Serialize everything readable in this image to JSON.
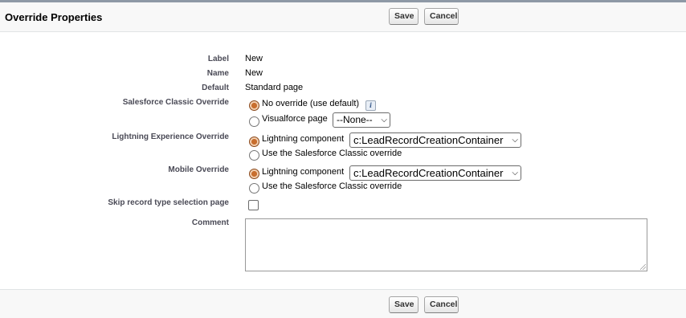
{
  "header": {
    "title": "Override Properties"
  },
  "buttons": {
    "save_label": "Save",
    "cancel_label": "Cancel"
  },
  "fields": {
    "label": {
      "label": "Label",
      "value": "New"
    },
    "name": {
      "label": "Name",
      "value": "New"
    },
    "default": {
      "label": "Default",
      "value": "Standard page"
    },
    "classic_override": {
      "label": "Salesforce Classic Override",
      "options": [
        "No override (use default)",
        "Visualforce page"
      ],
      "selected_index": 0,
      "vf_select_value": "--None--"
    },
    "lightning_override": {
      "label": "Lightning Experience Override",
      "options": [
        "Lightning component",
        "Use the Salesforce Classic override"
      ],
      "selected_index": 0,
      "component_value": "c:LeadRecordCreationContainer"
    },
    "mobile_override": {
      "label": "Mobile Override",
      "options": [
        "Lightning component",
        "Use the Salesforce Classic override"
      ],
      "selected_index": 0,
      "component_value": "c:LeadRecordCreationContainer"
    },
    "skip_record_type": {
      "label": "Skip record type selection page",
      "checked": false
    },
    "comment": {
      "label": "Comment",
      "value": ""
    }
  },
  "icons": {
    "info": "info-icon",
    "select_chevron": "chevron-down-icon"
  },
  "colors": {
    "radio_selected": "#c8773a",
    "header_bg": "#f8f8f8",
    "label_text": "#4a4a56"
  }
}
